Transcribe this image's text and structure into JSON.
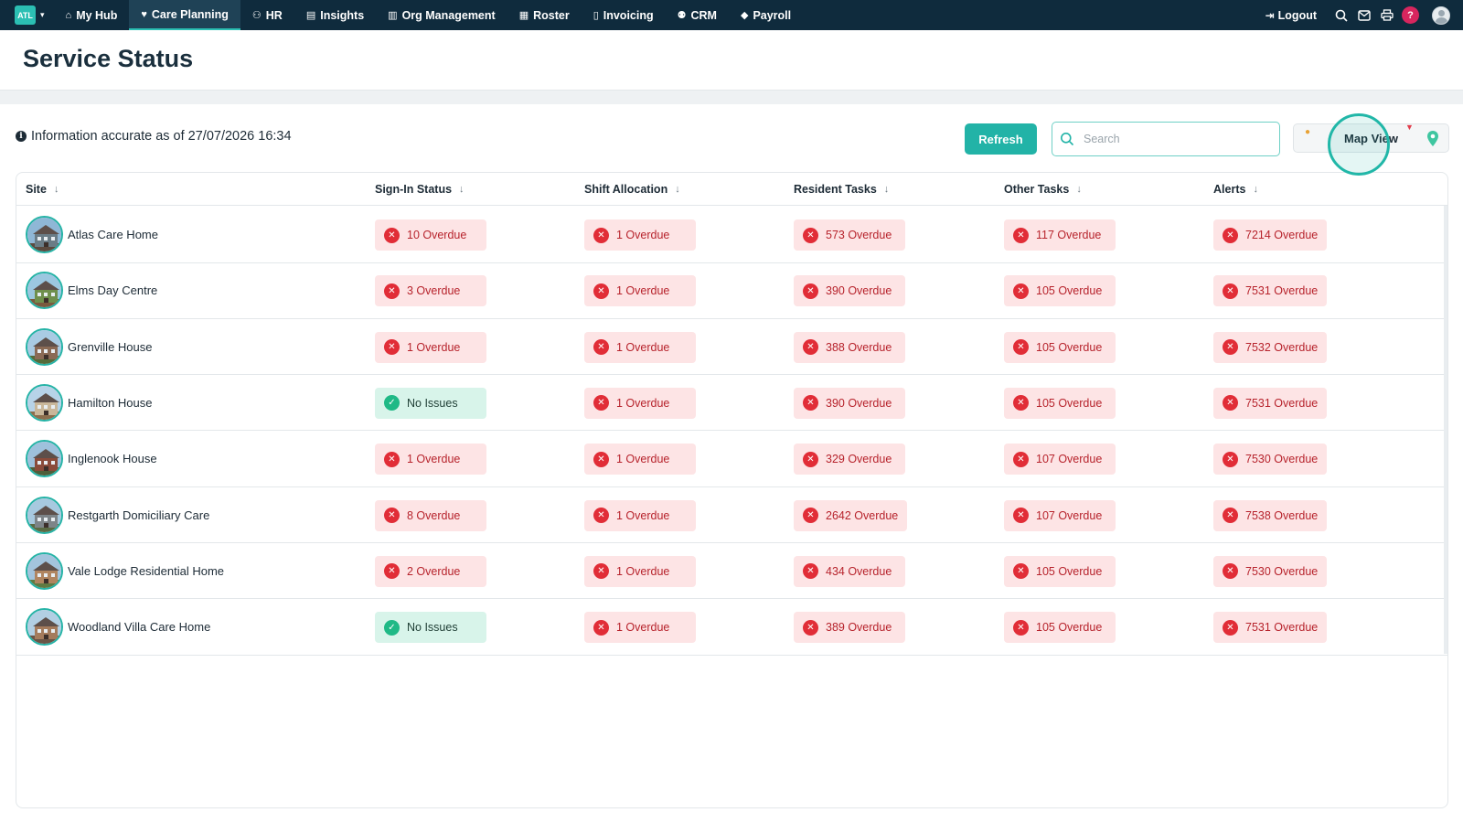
{
  "nav": {
    "brand": "ATL",
    "items": [
      {
        "label": "My Hub",
        "icon": "home-icon",
        "glyph": "⌂"
      },
      {
        "label": "Care Planning",
        "icon": "heart-icon",
        "glyph": "♥"
      },
      {
        "label": "HR",
        "icon": "people-icon",
        "glyph": "⚇"
      },
      {
        "label": "Insights",
        "icon": "chart-icon",
        "glyph": "▤"
      },
      {
        "label": "Org Management",
        "icon": "building-icon",
        "glyph": "▥"
      },
      {
        "label": "Roster",
        "icon": "calendar-icon",
        "glyph": "▦"
      },
      {
        "label": "Invoicing",
        "icon": "document-icon",
        "glyph": "▯"
      },
      {
        "label": "CRM",
        "icon": "contacts-icon",
        "glyph": "⚉"
      },
      {
        "label": "Payroll",
        "icon": "tag-icon",
        "glyph": "◆"
      }
    ],
    "active_index": 1,
    "logout_label": "Logout",
    "help_label": "?"
  },
  "page": {
    "title": "Service Status",
    "info_text": "Information accurate as of 27/07/2026 16:34",
    "refresh_label": "Refresh",
    "search_placeholder": "Search",
    "map_view_label": "Map View"
  },
  "colors": {
    "nav_bg": "#0f2b3d",
    "accent": "#22b3a7",
    "overdue_bg": "#fde4e5",
    "overdue_text": "#b7232c",
    "ok_bg": "#d8f4ea",
    "ok_icon": "#1fb986"
  },
  "table": {
    "columns": [
      "Site",
      "Sign-In Status",
      "Shift Allocation",
      "Resident Tasks",
      "Other Tasks",
      "Alerts"
    ],
    "rows": [
      {
        "site": "Atlas Care Home",
        "cells": [
          {
            "status": "overdue",
            "text": "10 Overdue"
          },
          {
            "status": "overdue",
            "text": "1 Overdue"
          },
          {
            "status": "overdue",
            "text": "573 Overdue"
          },
          {
            "status": "overdue",
            "text": "117 Overdue"
          },
          {
            "status": "overdue",
            "text": "7214 Overdue"
          }
        ]
      },
      {
        "site": "Elms Day Centre",
        "cells": [
          {
            "status": "overdue",
            "text": "3 Overdue"
          },
          {
            "status": "overdue",
            "text": "1 Overdue"
          },
          {
            "status": "overdue",
            "text": "390 Overdue"
          },
          {
            "status": "overdue",
            "text": "105 Overdue"
          },
          {
            "status": "overdue",
            "text": "7531 Overdue"
          }
        ]
      },
      {
        "site": "Grenville House",
        "cells": [
          {
            "status": "overdue",
            "text": "1 Overdue"
          },
          {
            "status": "overdue",
            "text": "1 Overdue"
          },
          {
            "status": "overdue",
            "text": "388 Overdue"
          },
          {
            "status": "overdue",
            "text": "105 Overdue"
          },
          {
            "status": "overdue",
            "text": "7532 Overdue"
          }
        ]
      },
      {
        "site": "Hamilton House",
        "cells": [
          {
            "status": "ok",
            "text": "No Issues"
          },
          {
            "status": "overdue",
            "text": "1 Overdue"
          },
          {
            "status": "overdue",
            "text": "390 Overdue"
          },
          {
            "status": "overdue",
            "text": "105 Overdue"
          },
          {
            "status": "overdue",
            "text": "7531 Overdue"
          }
        ]
      },
      {
        "site": "Inglenook House",
        "cells": [
          {
            "status": "overdue",
            "text": "1 Overdue"
          },
          {
            "status": "overdue",
            "text": "1 Overdue"
          },
          {
            "status": "overdue",
            "text": "329 Overdue"
          },
          {
            "status": "overdue",
            "text": "107 Overdue"
          },
          {
            "status": "overdue",
            "text": "7530 Overdue"
          }
        ]
      },
      {
        "site": "Restgarth Domiciliary Care",
        "cells": [
          {
            "status": "overdue",
            "text": "8 Overdue"
          },
          {
            "status": "overdue",
            "text": "1 Overdue"
          },
          {
            "status": "overdue",
            "text": "2642 Overdue"
          },
          {
            "status": "overdue",
            "text": "107 Overdue"
          },
          {
            "status": "overdue",
            "text": "7538 Overdue"
          }
        ]
      },
      {
        "site": "Vale Lodge Residential Home",
        "cells": [
          {
            "status": "overdue",
            "text": "2 Overdue"
          },
          {
            "status": "overdue",
            "text": "1 Overdue"
          },
          {
            "status": "overdue",
            "text": "434 Overdue"
          },
          {
            "status": "overdue",
            "text": "105 Overdue"
          },
          {
            "status": "overdue",
            "text": "7530 Overdue"
          }
        ]
      },
      {
        "site": "Woodland Villa Care Home",
        "cells": [
          {
            "status": "ok",
            "text": "No Issues"
          },
          {
            "status": "overdue",
            "text": "1 Overdue"
          },
          {
            "status": "overdue",
            "text": "389 Overdue"
          },
          {
            "status": "overdue",
            "text": "105 Overdue"
          },
          {
            "status": "overdue",
            "text": "7531 Overdue"
          }
        ]
      }
    ]
  }
}
